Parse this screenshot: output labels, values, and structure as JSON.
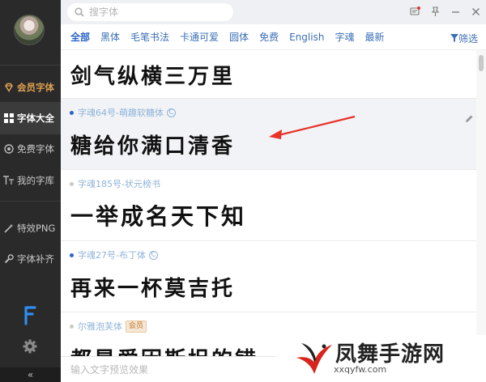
{
  "search": {
    "placeholder": "搜字体"
  },
  "sidebar": {
    "items": [
      {
        "label": "会员字体",
        "icon": "diamond-icon"
      },
      {
        "label": "字体大全",
        "icon": "grid-icon"
      },
      {
        "label": "免费字体",
        "icon": "coin-icon"
      },
      {
        "label": "我的字库",
        "icon": "font-tt-icon"
      },
      {
        "label": "特效PNG",
        "icon": "magic-wand-icon"
      },
      {
        "label": "字体补齐",
        "icon": "wrench-icon"
      }
    ],
    "collapse_label": "«"
  },
  "tabs": [
    "全部",
    "黑体",
    "毛笔书法",
    "卡通可爱",
    "圆体",
    "免费",
    "English",
    "字魂",
    "最新"
  ],
  "filter_label": "筛选",
  "fonts": [
    {
      "name": "",
      "sample": "剑气纵横三万里",
      "badge": ""
    },
    {
      "name": "字魂64号-萌趣软糖体",
      "sample": "糖给你满口清香",
      "badge": ""
    },
    {
      "name": "字魂185号-状元榜书",
      "sample": "一举成名天下知",
      "badge": ""
    },
    {
      "name": "字魂27号-布丁体",
      "sample": "再来一杯莫吉托",
      "badge": ""
    },
    {
      "name": "尔雅泡芙体",
      "sample": "都是爱因斯坦的错",
      "badge": "会员"
    }
  ],
  "preview": {
    "placeholder": "输入文字预览效果"
  },
  "watermark": {
    "title": "凤舞手游网",
    "url": "xxqyfw.com"
  },
  "colors": {
    "accent": "#2a63c9",
    "sidebar_bg": "#2a2a2a",
    "vip": "#e0a050",
    "arrow": "#e8322a"
  }
}
